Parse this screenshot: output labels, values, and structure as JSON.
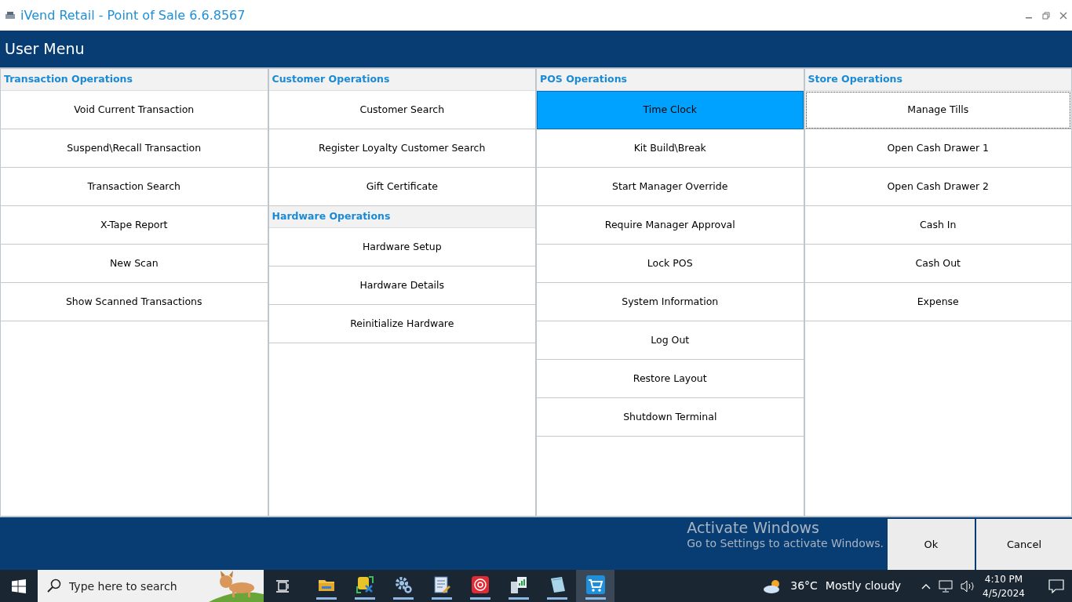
{
  "window": {
    "title": "iVend Retail - Point of Sale 6.6.8567"
  },
  "header": {
    "title": "User Menu"
  },
  "columns": [
    {
      "sections": [
        {
          "heading": "Transaction Operations",
          "items": [
            {
              "label": "Void Current Transaction",
              "selected": false,
              "focused": false
            },
            {
              "label": "Suspend\\Recall Transaction",
              "selected": false,
              "focused": false
            },
            {
              "label": "Transaction Search",
              "selected": false,
              "focused": false
            },
            {
              "label": "X-Tape Report",
              "selected": false,
              "focused": false
            },
            {
              "label": "New Scan",
              "selected": false,
              "focused": false
            },
            {
              "label": "Show Scanned Transactions",
              "selected": false,
              "focused": false
            }
          ]
        }
      ]
    },
    {
      "sections": [
        {
          "heading": "Customer Operations",
          "items": [
            {
              "label": "Customer Search",
              "selected": false,
              "focused": false
            },
            {
              "label": "Register Loyalty Customer Search",
              "selected": false,
              "focused": false
            },
            {
              "label": "Gift Certificate",
              "selected": false,
              "focused": false
            }
          ]
        },
        {
          "heading": "Hardware Operations",
          "items": [
            {
              "label": "Hardware Setup",
              "selected": false,
              "focused": false
            },
            {
              "label": "Hardware Details",
              "selected": false,
              "focused": false
            },
            {
              "label": "Reinitialize Hardware",
              "selected": false,
              "focused": false
            }
          ]
        }
      ]
    },
    {
      "sections": [
        {
          "heading": "POS Operations",
          "items": [
            {
              "label": "Time Clock",
              "selected": true,
              "focused": false
            },
            {
              "label": "Kit Build\\Break",
              "selected": false,
              "focused": false
            },
            {
              "label": "Start Manager Override",
              "selected": false,
              "focused": false
            },
            {
              "label": "Require Manager Approval",
              "selected": false,
              "focused": false
            },
            {
              "label": "Lock POS",
              "selected": false,
              "focused": false
            },
            {
              "label": "System Information",
              "selected": false,
              "focused": false
            },
            {
              "label": "Log Out",
              "selected": false,
              "focused": false
            },
            {
              "label": "Restore Layout",
              "selected": false,
              "focused": false
            },
            {
              "label": "Shutdown Terminal",
              "selected": false,
              "focused": false
            }
          ]
        }
      ]
    },
    {
      "sections": [
        {
          "heading": "Store Operations",
          "items": [
            {
              "label": "Manage Tills",
              "selected": false,
              "focused": true
            },
            {
              "label": "Open Cash Drawer 1",
              "selected": false,
              "focused": false
            },
            {
              "label": "Open Cash Drawer 2",
              "selected": false,
              "focused": false
            },
            {
              "label": "Cash In",
              "selected": false,
              "focused": false
            },
            {
              "label": "Cash Out",
              "selected": false,
              "focused": false
            },
            {
              "label": "Expense",
              "selected": false,
              "focused": false
            }
          ]
        }
      ]
    }
  ],
  "footer": {
    "buttons": [
      "Ok",
      "Cancel"
    ]
  },
  "activation_notice": {
    "title": "Activate Windows",
    "message": "Go to Settings to activate Windows."
  },
  "taskbar": {
    "search": {
      "placeholder": "Type here to search"
    },
    "apps": [
      {
        "kind": "folder",
        "running": true,
        "active": false
      },
      {
        "kind": "database",
        "running": true,
        "active": false
      },
      {
        "kind": "gears",
        "running": true,
        "active": false
      },
      {
        "kind": "document",
        "running": true,
        "active": false
      },
      {
        "kind": "target",
        "running": true,
        "active": false
      },
      {
        "kind": "server",
        "running": true,
        "active": false
      },
      {
        "kind": "notepad",
        "running": true,
        "active": false
      },
      {
        "kind": "cart",
        "running": true,
        "active": true
      }
    ],
    "weather": {
      "temperature": "36°C",
      "condition": "Mostly cloudy"
    },
    "clock": {
      "time": "4:10 PM",
      "date": "4/5/2024"
    }
  }
}
